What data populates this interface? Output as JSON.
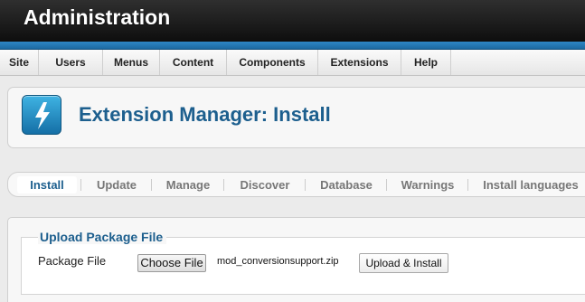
{
  "header": {
    "title": "Administration"
  },
  "menu": {
    "items": [
      {
        "label": "Site"
      },
      {
        "label": "Users"
      },
      {
        "label": "Menus"
      },
      {
        "label": "Content"
      },
      {
        "label": "Components"
      },
      {
        "label": "Extensions"
      },
      {
        "label": "Help"
      }
    ]
  },
  "page": {
    "title": "Extension Manager: Install",
    "icon": "lightning-icon"
  },
  "tabs": [
    {
      "label": "Install",
      "active": true
    },
    {
      "label": "Update",
      "active": false
    },
    {
      "label": "Manage",
      "active": false
    },
    {
      "label": "Discover",
      "active": false
    },
    {
      "label": "Database",
      "active": false
    },
    {
      "label": "Warnings",
      "active": false
    },
    {
      "label": "Install languages",
      "active": false
    }
  ],
  "upload": {
    "legend": "Upload Package File",
    "field_label": "Package File",
    "choose_label": "Choose File",
    "file_name": "mod_conversionsupport.zip",
    "submit_label": "Upload & Install"
  },
  "colors": {
    "header_bg": "#141414",
    "accent_blue": "#2a7fbd",
    "title_blue": "#1d5f8e"
  }
}
